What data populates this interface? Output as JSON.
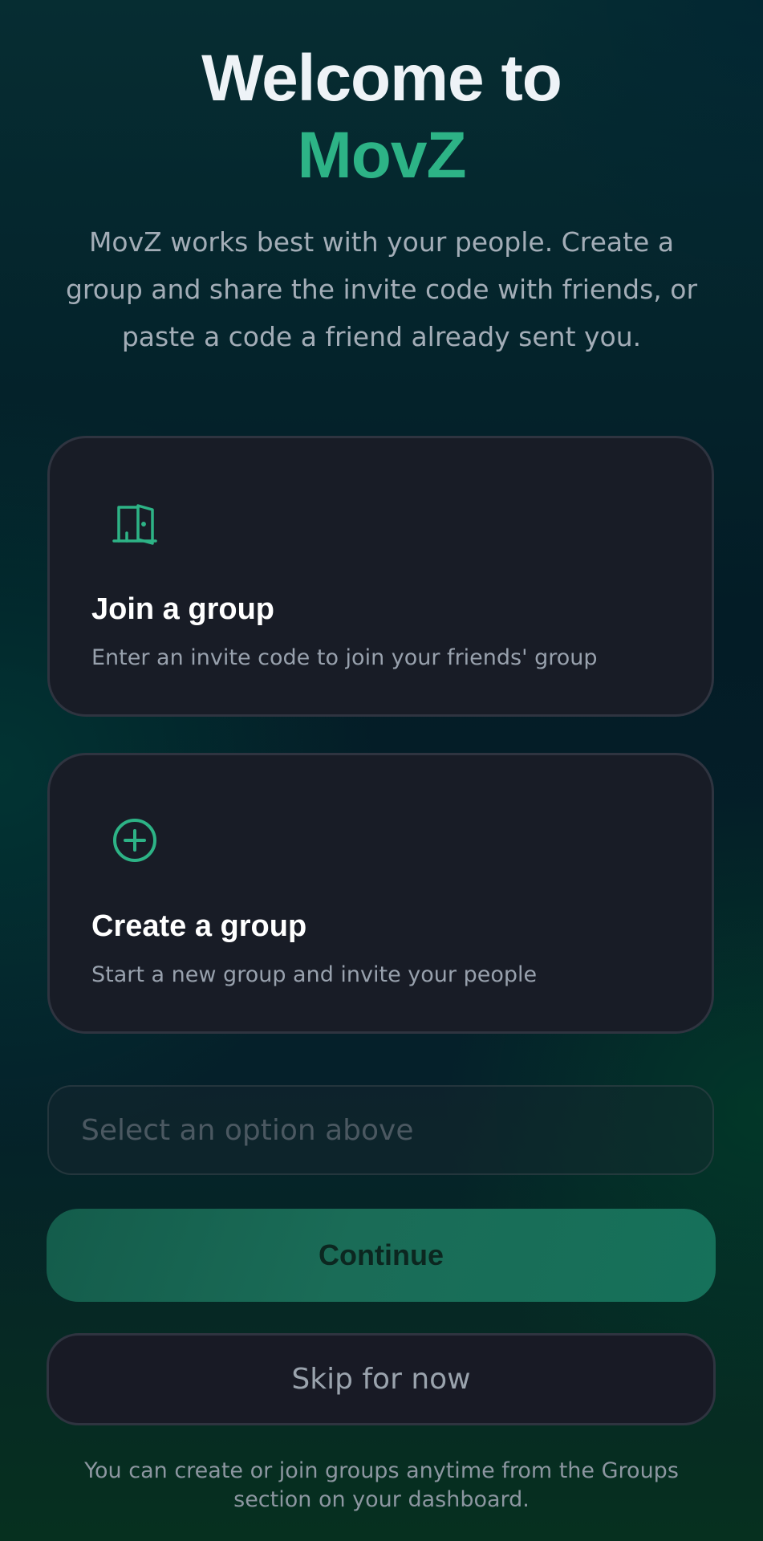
{
  "header": {
    "title_line1": "Welcome to",
    "title_line2": "MovZ",
    "subtitle": "MovZ works best with your people. Create a group and share the invite code with friends, or paste a code a friend already sent you."
  },
  "options": {
    "join": {
      "icon": "door-icon",
      "title": "Join a group",
      "description": "Enter an invite code to join your friends' group"
    },
    "create": {
      "icon": "plus-circle-icon",
      "title": "Create a group",
      "description": "Start a new group and invite your people"
    }
  },
  "code_input": {
    "value": "",
    "placeholder": "Select an option above"
  },
  "actions": {
    "continue_label": "Continue",
    "skip_label": "Skip for now"
  },
  "footer": {
    "note": "You can create or join groups anytime from the Groups section on your dashboard."
  },
  "colors": {
    "accent": "#2db386",
    "card_background": "#181c26",
    "continue_button": "#1a6c57"
  }
}
